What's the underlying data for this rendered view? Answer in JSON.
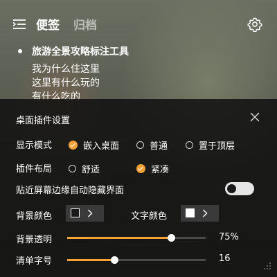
{
  "tabs": [
    {
      "label": "便签"
    },
    {
      "label": "归档"
    }
  ],
  "note": {
    "title": "旅游全景攻略标注工具",
    "lines": [
      "我为什么住这里",
      "这里有什么玩的",
      "有什么吃的"
    ]
  },
  "settings": {
    "title": "桌面插件设置",
    "display_mode": {
      "label": "显示模式",
      "options": [
        "嵌入桌面",
        "普通",
        "置于顶层"
      ],
      "selected": "嵌入桌面"
    },
    "layout": {
      "label": "插件布局",
      "options": [
        "舒适",
        "紧凑"
      ],
      "selected": "紧凑"
    },
    "auto_hide": {
      "label": "贴近屏幕边缘自动隐藏界面",
      "enabled": false
    },
    "bg_color": {
      "label": "背景颜色",
      "value": "#1a1a1a"
    },
    "text_color": {
      "label": "文字颜色",
      "value": "#ffffff"
    },
    "bg_opacity": {
      "label": "背景透明",
      "value_text": "75%",
      "fraction": 0.75
    },
    "font_size": {
      "label": "清单字号",
      "value_text": "16",
      "fraction": 0.34
    }
  },
  "colors": {
    "accent": "#f5a135"
  },
  "icons": [
    "menu-icon",
    "gear-icon",
    "close-icon",
    "chevron-right-icon",
    "resize-grip-icon"
  ]
}
